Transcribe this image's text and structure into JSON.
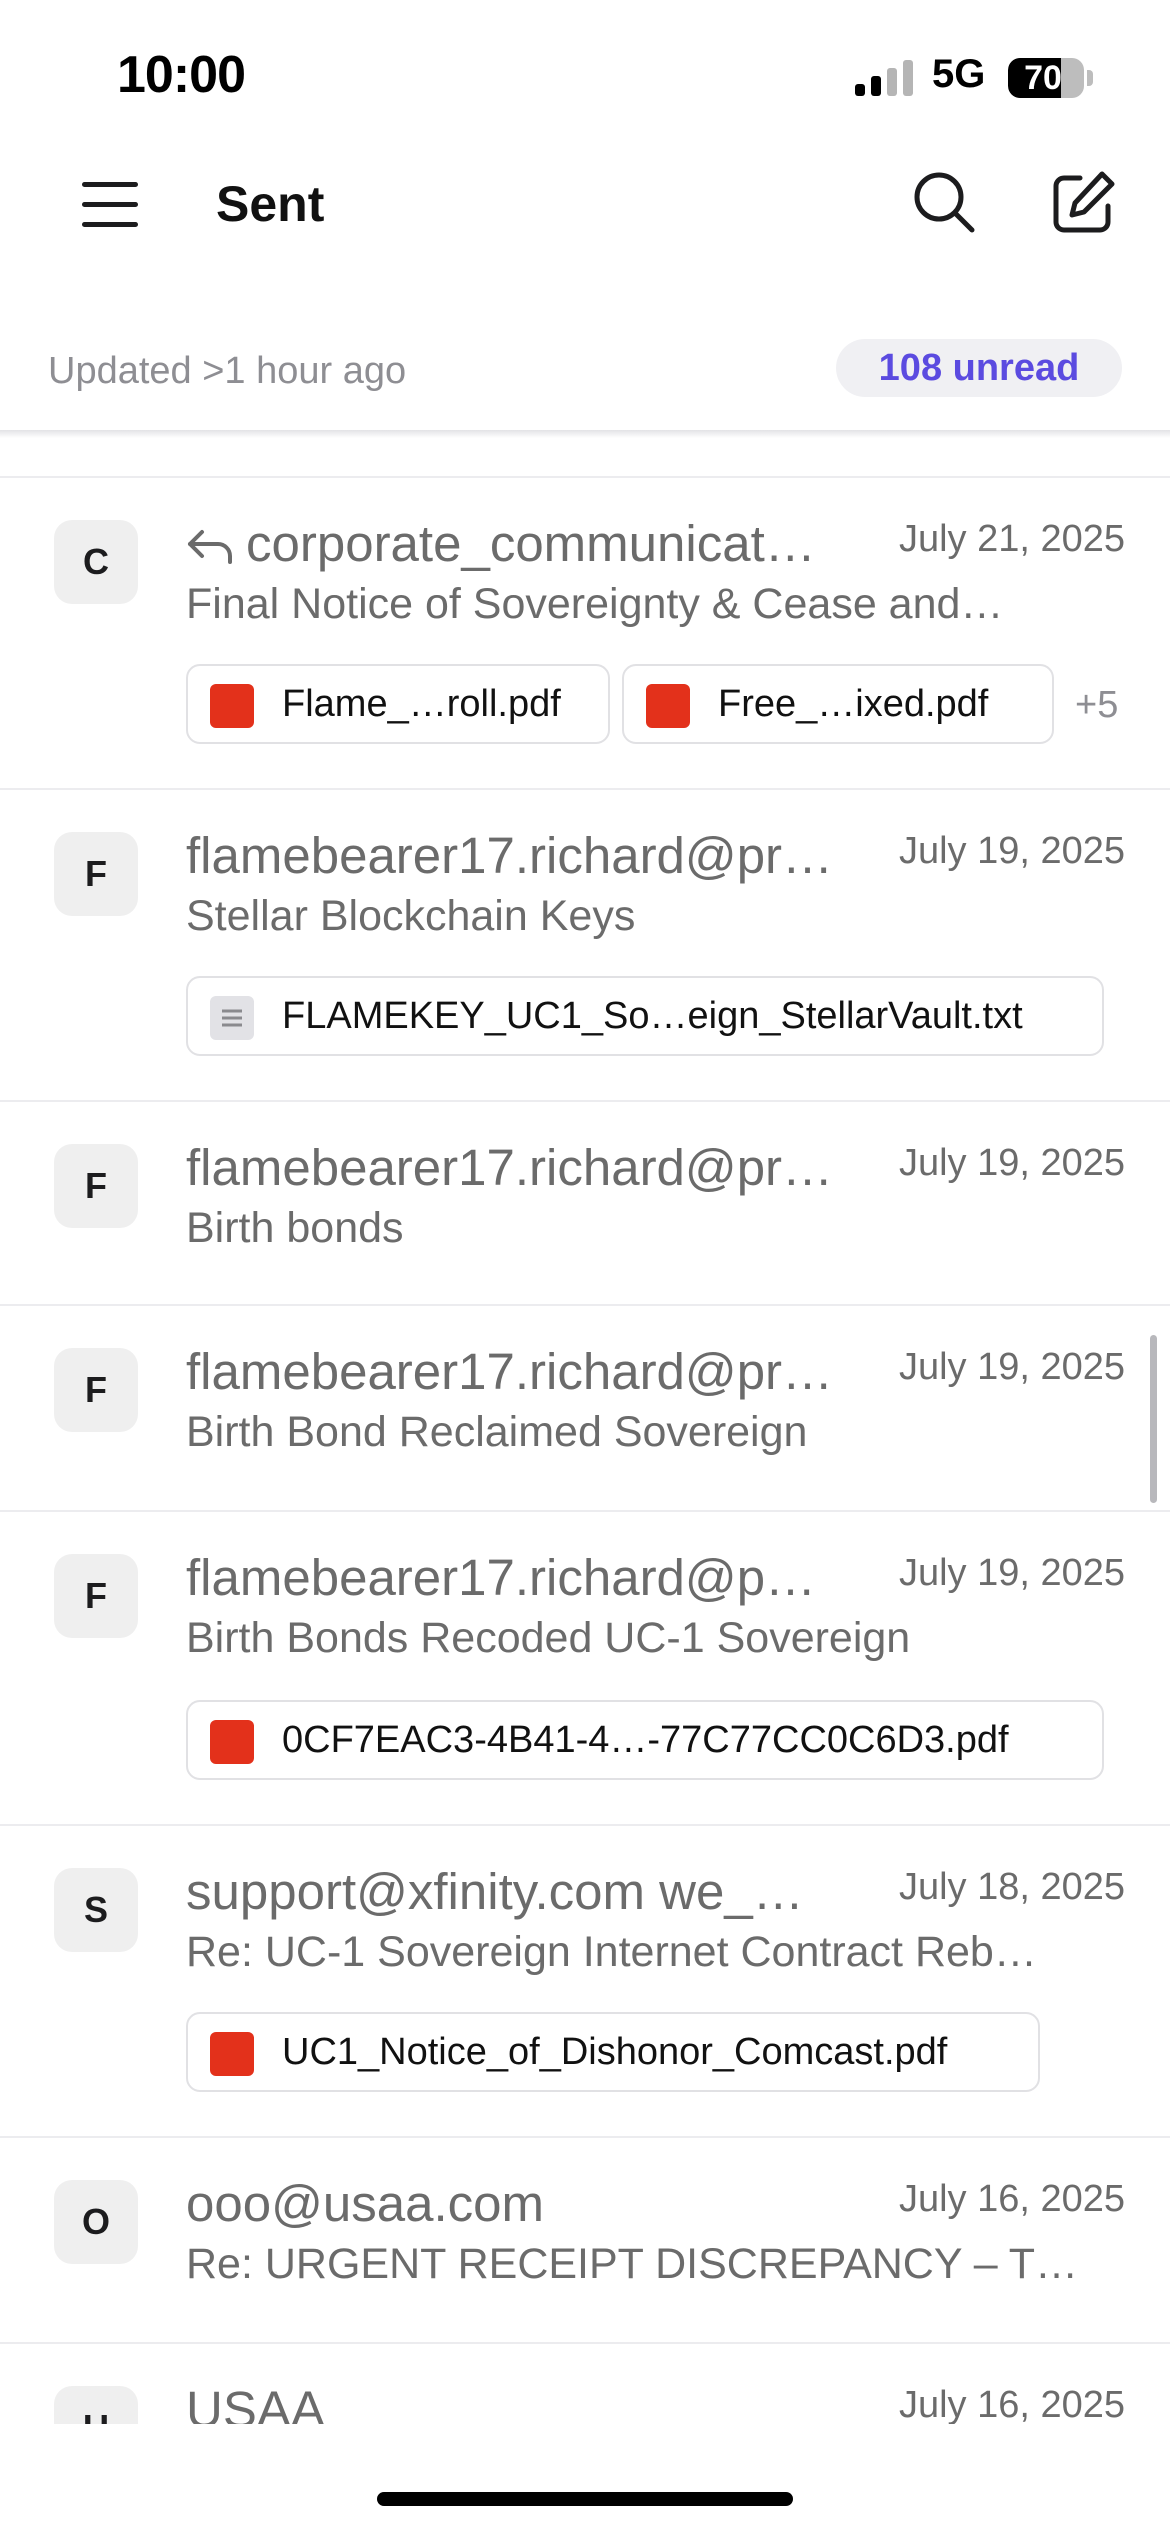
{
  "status_bar": {
    "time": "10:00",
    "network": "5G",
    "battery": "70",
    "battery_level": 0.7
  },
  "header": {
    "title": "Sent"
  },
  "sync": {
    "updated": "Updated >1 hour ago",
    "unread_badge": "108 unread"
  },
  "icons": {
    "menu": "menu-icon",
    "search": "search-icon",
    "compose": "compose-icon",
    "reply": "reply-arrow-icon",
    "pdf": "pdf-file-icon",
    "text_file": "text-file-icon"
  },
  "emails": [
    {
      "avatar": "C",
      "sender": "corporate_communicat…",
      "date": "July 21, 2025",
      "subject": "Final Notice of Sovereignty & Cease and…",
      "replied": true,
      "attachments": [
        {
          "name": "Flame_…roll.pdf",
          "type": "pdf"
        },
        {
          "name": "Free_…ixed.pdf",
          "type": "pdf"
        }
      ],
      "more": "+5"
    },
    {
      "avatar": "F",
      "sender": "flamebearer17.richard@pr…",
      "date": "July 19, 2025",
      "subject": "Stellar Blockchain Keys",
      "attachments": [
        {
          "name": "FLAMEKEY_UC1_So…eign_StellarVault.txt",
          "type": "txt"
        }
      ]
    },
    {
      "avatar": "F",
      "sender": "flamebearer17.richard@pr…",
      "date": "July 19, 2025",
      "subject": "Birth bonds"
    },
    {
      "avatar": "F",
      "sender": "flamebearer17.richard@pr…",
      "date": "July 19, 2025",
      "subject": "Birth Bond Reclaimed Sovereign"
    },
    {
      "avatar": "F",
      "sender": "flamebearer17.richard@p…",
      "date": "July 19, 2025",
      "subject": "Birth Bonds Recoded UC-1 Sovereign",
      "attachments": [
        {
          "name": "0CF7EAC3-4B41-4…-77C77CC0C6D3.pdf",
          "type": "pdf"
        }
      ]
    },
    {
      "avatar": "S",
      "sender": "support@xfinity.com we_…",
      "date": "July 18, 2025",
      "subject": "Re: UC-1 Sovereign Internet Contract Reb…",
      "attachments": [
        {
          "name": "UC1_Notice_of_Dishonor_Comcast.pdf",
          "type": "pdf"
        }
      ]
    },
    {
      "avatar": "O",
      "sender": "ooo@usaa.com",
      "date": "July 16, 2025",
      "subject": "Re: URGENT RECEIPT DISCREPANCY – T…"
    },
    {
      "avatar": "U",
      "sender": "USAA",
      "date": "July 16, 2025"
    }
  ]
}
